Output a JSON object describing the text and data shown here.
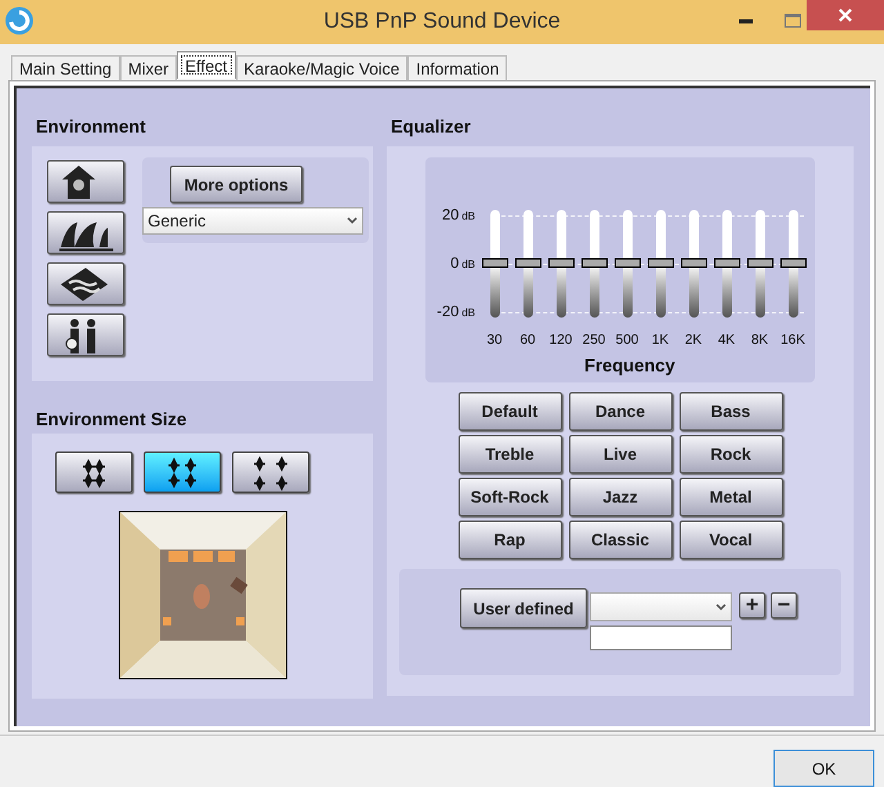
{
  "window": {
    "title": "USB PnP Sound Device"
  },
  "tabs": [
    {
      "label": "Main Setting",
      "selected": false
    },
    {
      "label": "Mixer",
      "selected": false
    },
    {
      "label": "Effect",
      "selected": true
    },
    {
      "label": "Karaoke/Magic Voice",
      "selected": false
    },
    {
      "label": "Information",
      "selected": false
    }
  ],
  "environment": {
    "heading": "Environment",
    "presets": [
      {
        "kind": "house"
      },
      {
        "kind": "opera"
      },
      {
        "kind": "water"
      },
      {
        "kind": "people"
      }
    ],
    "more_options": "More options",
    "dropdown": {
      "value": "Generic"
    }
  },
  "environment_size": {
    "heading": "Environment Size",
    "sizes": [
      {
        "kind": "small",
        "selected": false
      },
      {
        "kind": "medium",
        "selected": true
      },
      {
        "kind": "large",
        "selected": false
      }
    ]
  },
  "equalizer": {
    "heading": "Equalizer",
    "scale": [
      {
        "value": "20",
        "unit": "dB"
      },
      {
        "value": "0",
        "unit": "dB"
      },
      {
        "value": "-20",
        "unit": "dB"
      }
    ],
    "xlabel": "Frequency",
    "bands": [
      {
        "label": "30",
        "level": 0.5
      },
      {
        "label": "60",
        "level": 0.5
      },
      {
        "label": "120",
        "level": 0.5
      },
      {
        "label": "250",
        "level": 0.5
      },
      {
        "label": "500",
        "level": 0.5
      },
      {
        "label": "1K",
        "level": 0.5
      },
      {
        "label": "2K",
        "level": 0.5
      },
      {
        "label": "4K",
        "level": 0.5
      },
      {
        "label": "8K",
        "level": 0.5
      },
      {
        "label": "16K",
        "level": 0.5
      }
    ],
    "presets": [
      "Default",
      "Dance",
      "Bass",
      "Treble",
      "Live",
      "Rock",
      "Soft-Rock",
      "Jazz",
      "Metal",
      "Rap",
      "Classic",
      "Vocal"
    ],
    "user_defined": {
      "button": "User defined",
      "add": "+",
      "remove": "−"
    }
  },
  "footer": {
    "ok": "OK"
  }
}
